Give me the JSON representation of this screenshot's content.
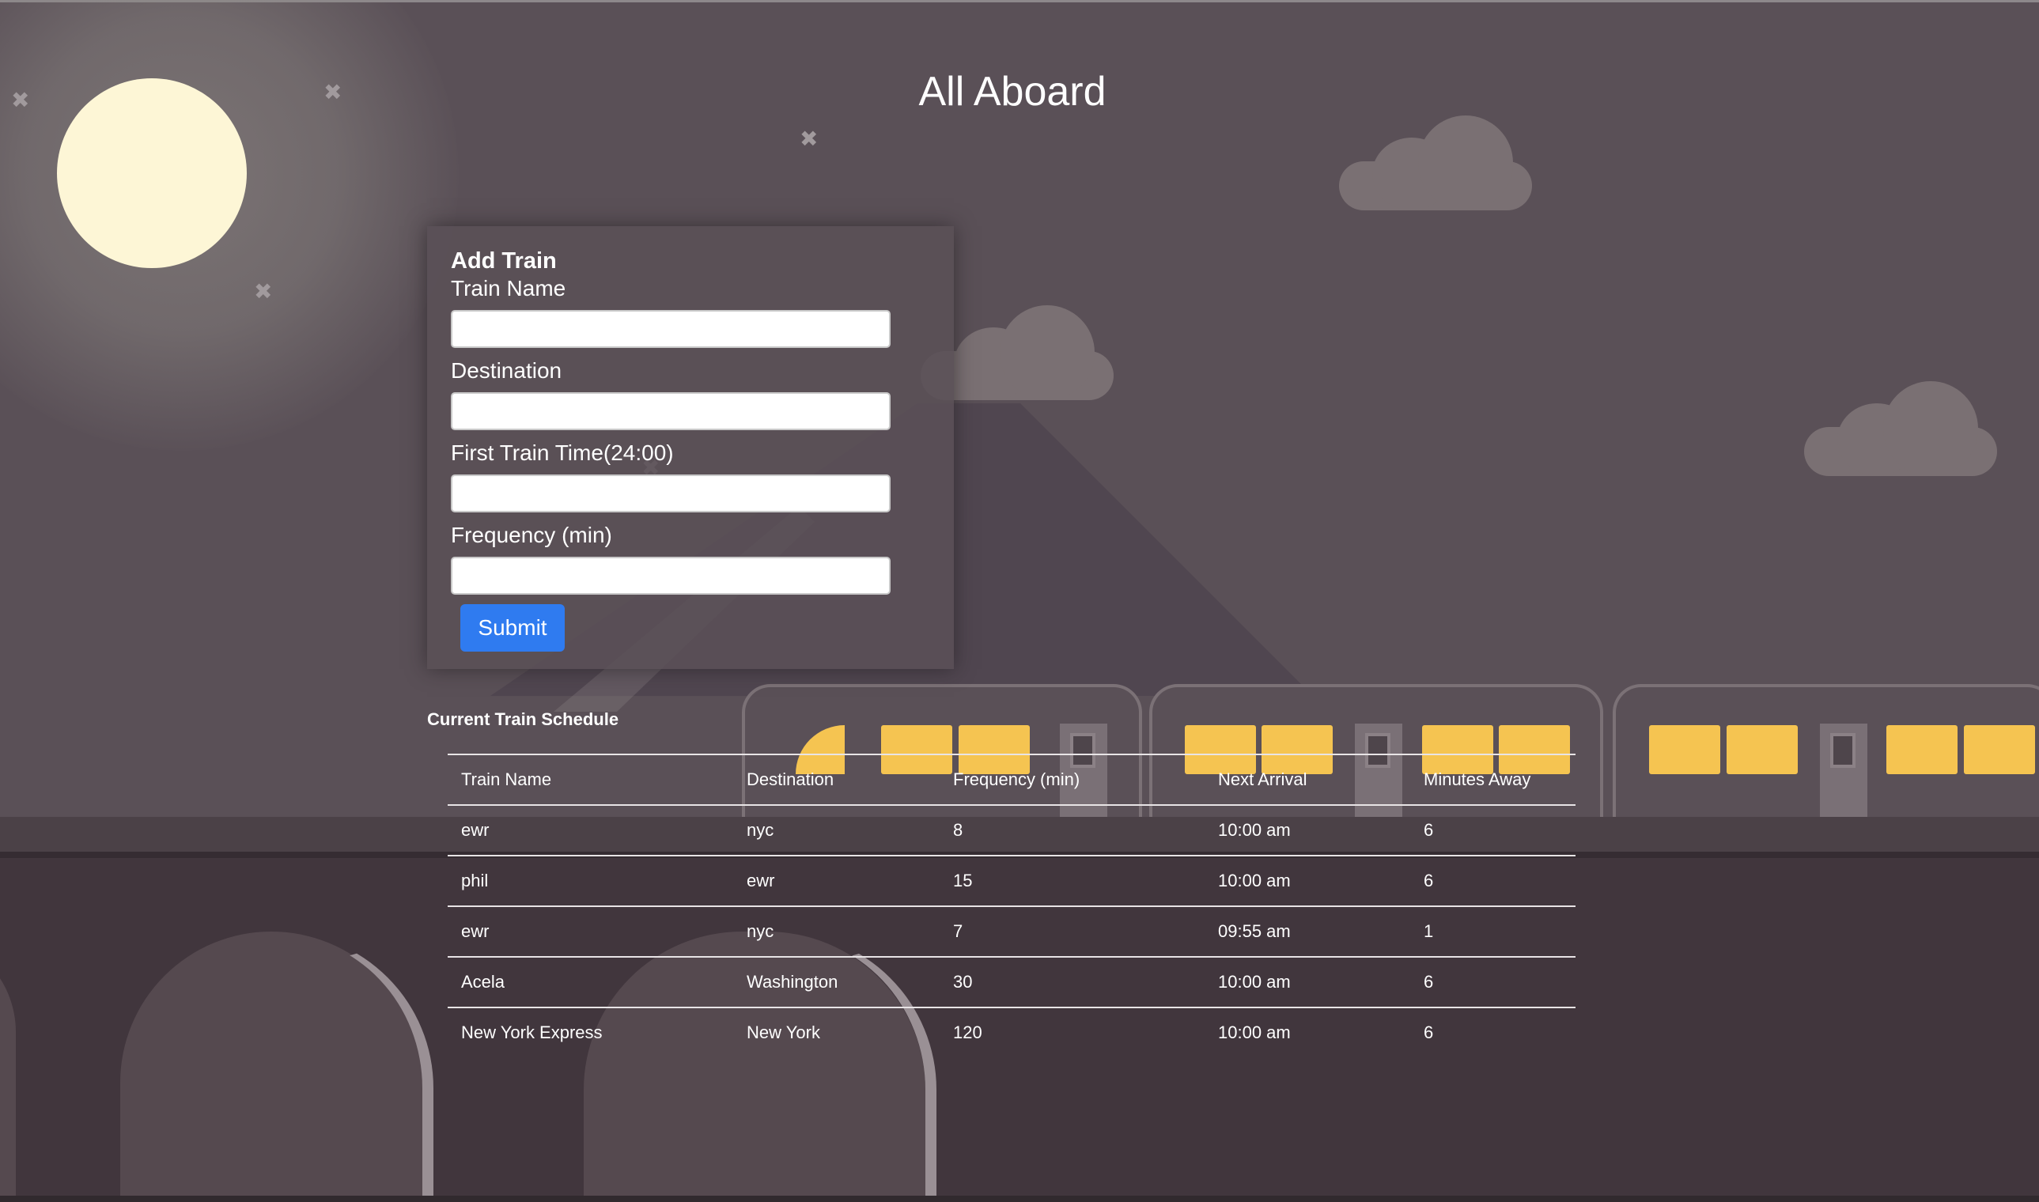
{
  "page": {
    "title": "All Aboard"
  },
  "form": {
    "heading": "Add Train",
    "fields": [
      {
        "label": "Train Name",
        "value": "",
        "placeholder": ""
      },
      {
        "label": "Destination",
        "value": "",
        "placeholder": ""
      },
      {
        "label": "First Train Time(24:00)",
        "value": "",
        "placeholder": ""
      },
      {
        "label": "Frequency (min)",
        "value": "",
        "placeholder": ""
      }
    ],
    "submit_label": "Submit"
  },
  "schedule": {
    "title": "Current Train Schedule",
    "columns": [
      "Train Name",
      "Destination",
      "Frequency (min)",
      "Next Arrival",
      "Minutes Away"
    ],
    "rows": [
      [
        "ewr",
        "nyc",
        "8",
        "10:00 am",
        "6"
      ],
      [
        "phil",
        "ewr",
        "15",
        "10:00 am",
        "6"
      ],
      [
        "ewr",
        "nyc",
        "7",
        "09:55 am",
        "1"
      ],
      [
        "Acela",
        "Washington",
        "30",
        "10:00 am",
        "6"
      ],
      [
        "New York Express",
        "New York",
        "120",
        "10:00 am",
        "6"
      ]
    ]
  },
  "colors": {
    "sky": "#5a5057",
    "moon": "#fdf6d6",
    "train_window": "#f5c451",
    "submit_button": "#2f7bf0",
    "ground": "#41363d"
  }
}
